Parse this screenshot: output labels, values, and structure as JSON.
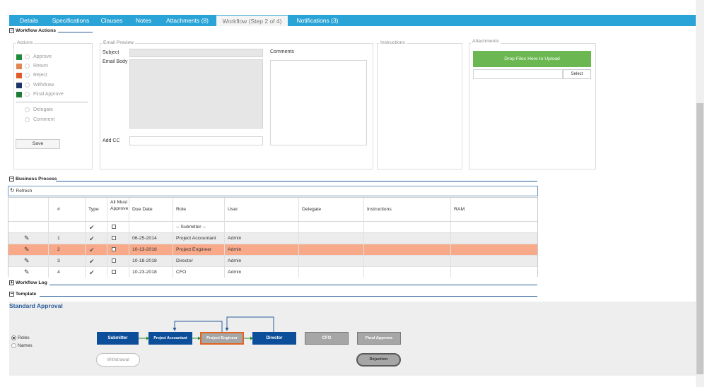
{
  "tabs": [
    {
      "label": "Details"
    },
    {
      "label": "Specifications"
    },
    {
      "label": "Clauses"
    },
    {
      "label": "Notes"
    },
    {
      "label": "Attachments (8)"
    },
    {
      "label": "Workflow (Step 2 of 4)"
    },
    {
      "label": "Notifications (3)"
    }
  ],
  "workflow_actions": {
    "title": "Workflow Actions",
    "actions_legend": "Actions",
    "actions": [
      {
        "label": "Approve",
        "color": "#1f8a3a"
      },
      {
        "label": "Return",
        "color": "#e08552"
      },
      {
        "label": "Reject",
        "color": "#e05a2a"
      },
      {
        "label": "Withdraw",
        "color": "#1d3566"
      },
      {
        "label": "Final Approve",
        "color": "#1f7a36"
      }
    ],
    "extra_options": [
      {
        "label": "Delegate"
      },
      {
        "label": "Comment"
      }
    ],
    "save_label": "Save",
    "email_legend": "Email Preview",
    "subject_label": "Subject",
    "email_body_label": "Email Body",
    "add_cc_label": "Add CC",
    "comments_label": "Comments",
    "instructions_legend": "Instructions",
    "attachments_legend": "Attachments",
    "drop_label": "Drop Files Here to Upload",
    "select_label": "Select"
  },
  "business_process": {
    "title": "Business Process",
    "refresh_label": "Refresh",
    "columns": {
      "num": "#",
      "type": "Type",
      "all_must_approve": "All Must Approve",
      "due_date": "Due Date",
      "role": "Role",
      "user": "User",
      "delegate": "Delegate",
      "instructions": "Instructions",
      "ram": "RAM"
    },
    "rows": [
      {
        "num": "",
        "due": "",
        "role": "-- Submitter --",
        "user": ""
      },
      {
        "num": "1",
        "due": "06-25-2014",
        "role": "Project Accountant",
        "user": "Admin"
      },
      {
        "num": "2",
        "due": "10-13-2018",
        "role": "Project Engineer",
        "user": "Admin"
      },
      {
        "num": "3",
        "due": "10-18-2018",
        "role": "Director",
        "user": "Admin"
      },
      {
        "num": "4",
        "due": "10-23-2018",
        "role": "CFO",
        "user": "Admin"
      }
    ]
  },
  "workflow_log": {
    "title": "Workflow Log"
  },
  "template": {
    "title": "Template",
    "name": "Standard Approval",
    "view_options": [
      {
        "label": "Roles",
        "selected": true
      },
      {
        "label": "Names",
        "selected": false
      }
    ],
    "steps": [
      {
        "label": "Submitter"
      },
      {
        "label": "Project Accountant"
      },
      {
        "label": "Project Engineer"
      },
      {
        "label": "Director"
      },
      {
        "label": "CFO"
      },
      {
        "label": "Final Approve"
      }
    ],
    "withdrawal_label": "Withdrawal",
    "rejection_label": "Rejection"
  }
}
